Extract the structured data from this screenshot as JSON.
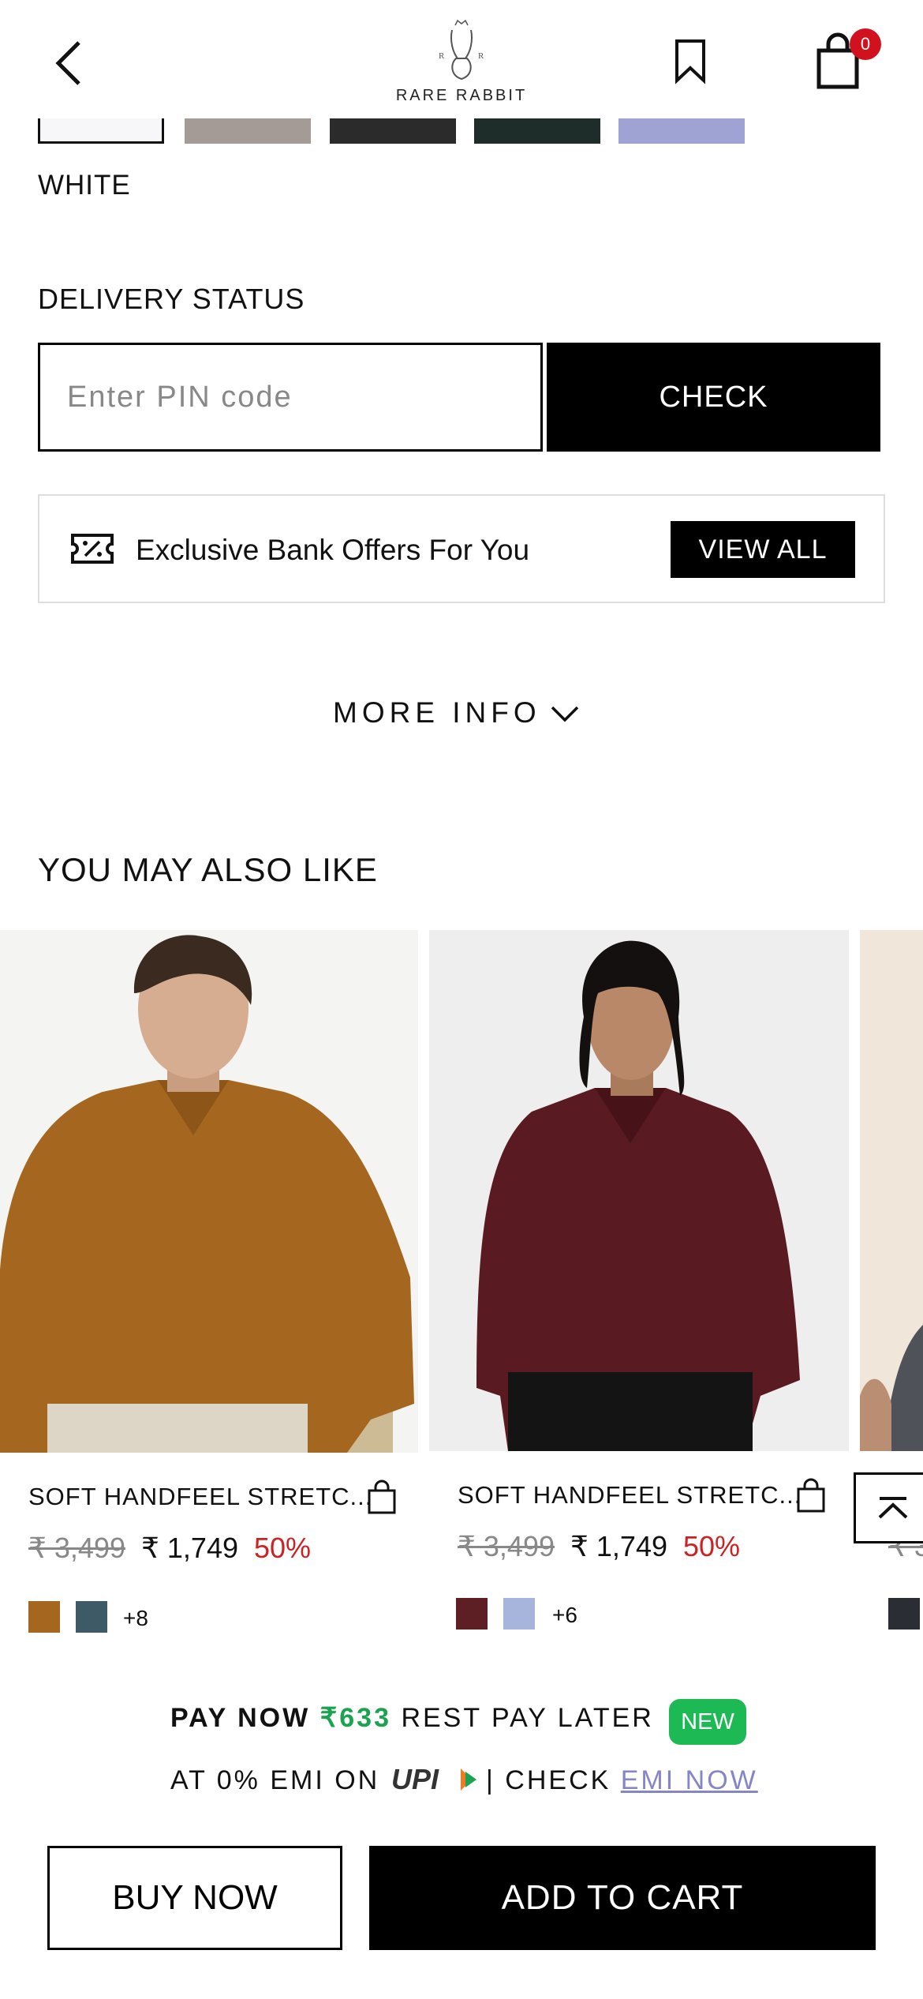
{
  "header": {
    "brand": "RARE RABBIT",
    "cart_count": "0"
  },
  "swatch_colors": [
    "#f7f7f9",
    "#a59b96",
    "#2b2b2b",
    "#1f2d2a",
    "#9ea3d4"
  ],
  "selected_color": "WHITE",
  "delivery": {
    "title": "DELIVERY STATUS",
    "pin_placeholder": "Enter PIN code",
    "check_label": "CHECK"
  },
  "offers": {
    "text": "Exclusive Bank Offers For You",
    "view_all": "VIEW ALL"
  },
  "more_info": "MORE INFO",
  "recommendations": {
    "title": "YOU MAY ALSO LIKE",
    "products": [
      {
        "name": "SOFT HANDFEEL STRETC...",
        "mrp": "₹ 3,499",
        "price": "₹ 1,749",
        "discount": "50%",
        "shirt_color": "#a5661f",
        "colors": [
          "#a5661f",
          "#3e5a66"
        ],
        "more_colors": "+8"
      },
      {
        "name": "SOFT HANDFEEL STRETC...",
        "mrp": "₹ 3,499",
        "price": "₹ 1,749",
        "discount": "50%",
        "shirt_color": "#5a1a22",
        "colors": [
          "#5e1f24",
          "#a7b5dc"
        ],
        "more_colors": "+6"
      },
      {
        "name": "",
        "mrp": "₹ 3",
        "colors": [
          "#2a2d33"
        ]
      }
    ]
  },
  "pay_later": {
    "pay_now": "PAY NOW",
    "amount": "₹633",
    "rest": "REST PAY LATER",
    "badge": "NEW",
    "emi_prefix": "AT 0% EMI ON",
    "upi": "UPI",
    "check": "| CHECK",
    "emi_link": "EMI NOW"
  },
  "actions": {
    "buy_now": "BUY NOW",
    "add_to_cart": "ADD TO CART"
  }
}
